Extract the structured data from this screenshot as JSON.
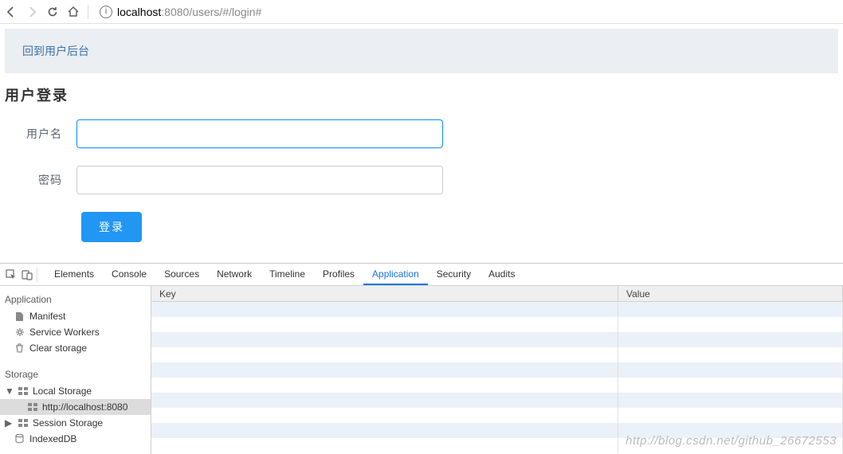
{
  "browser": {
    "url_host": "localhost",
    "url_port": ":8080",
    "url_path": "/users/#/login#"
  },
  "page": {
    "banner_link": "回到用户后台",
    "title": "用户登录",
    "labels": {
      "username": "用户名",
      "password": "密码"
    },
    "values": {
      "username": "",
      "password": ""
    },
    "login_button": "登录"
  },
  "devtools": {
    "tabs": [
      "Elements",
      "Console",
      "Sources",
      "Network",
      "Timeline",
      "Profiles",
      "Application",
      "Security",
      "Audits"
    ],
    "active_tab": "Application",
    "sidebar": {
      "app_heading": "Application",
      "app_items": [
        "Manifest",
        "Service Workers",
        "Clear storage"
      ],
      "storage_heading": "Storage",
      "storage_tree": {
        "local_storage": {
          "label": "Local Storage",
          "expanded": true,
          "children": [
            "http://localhost:8080"
          ],
          "selected_child": 0
        },
        "session_storage": {
          "label": "Session Storage",
          "expanded": false
        },
        "indexeddb": {
          "label": "IndexedDB"
        }
      }
    },
    "table": {
      "columns": [
        "Key",
        "Value"
      ],
      "rows": []
    }
  },
  "watermark": "http://blog.csdn.net/github_26672553"
}
